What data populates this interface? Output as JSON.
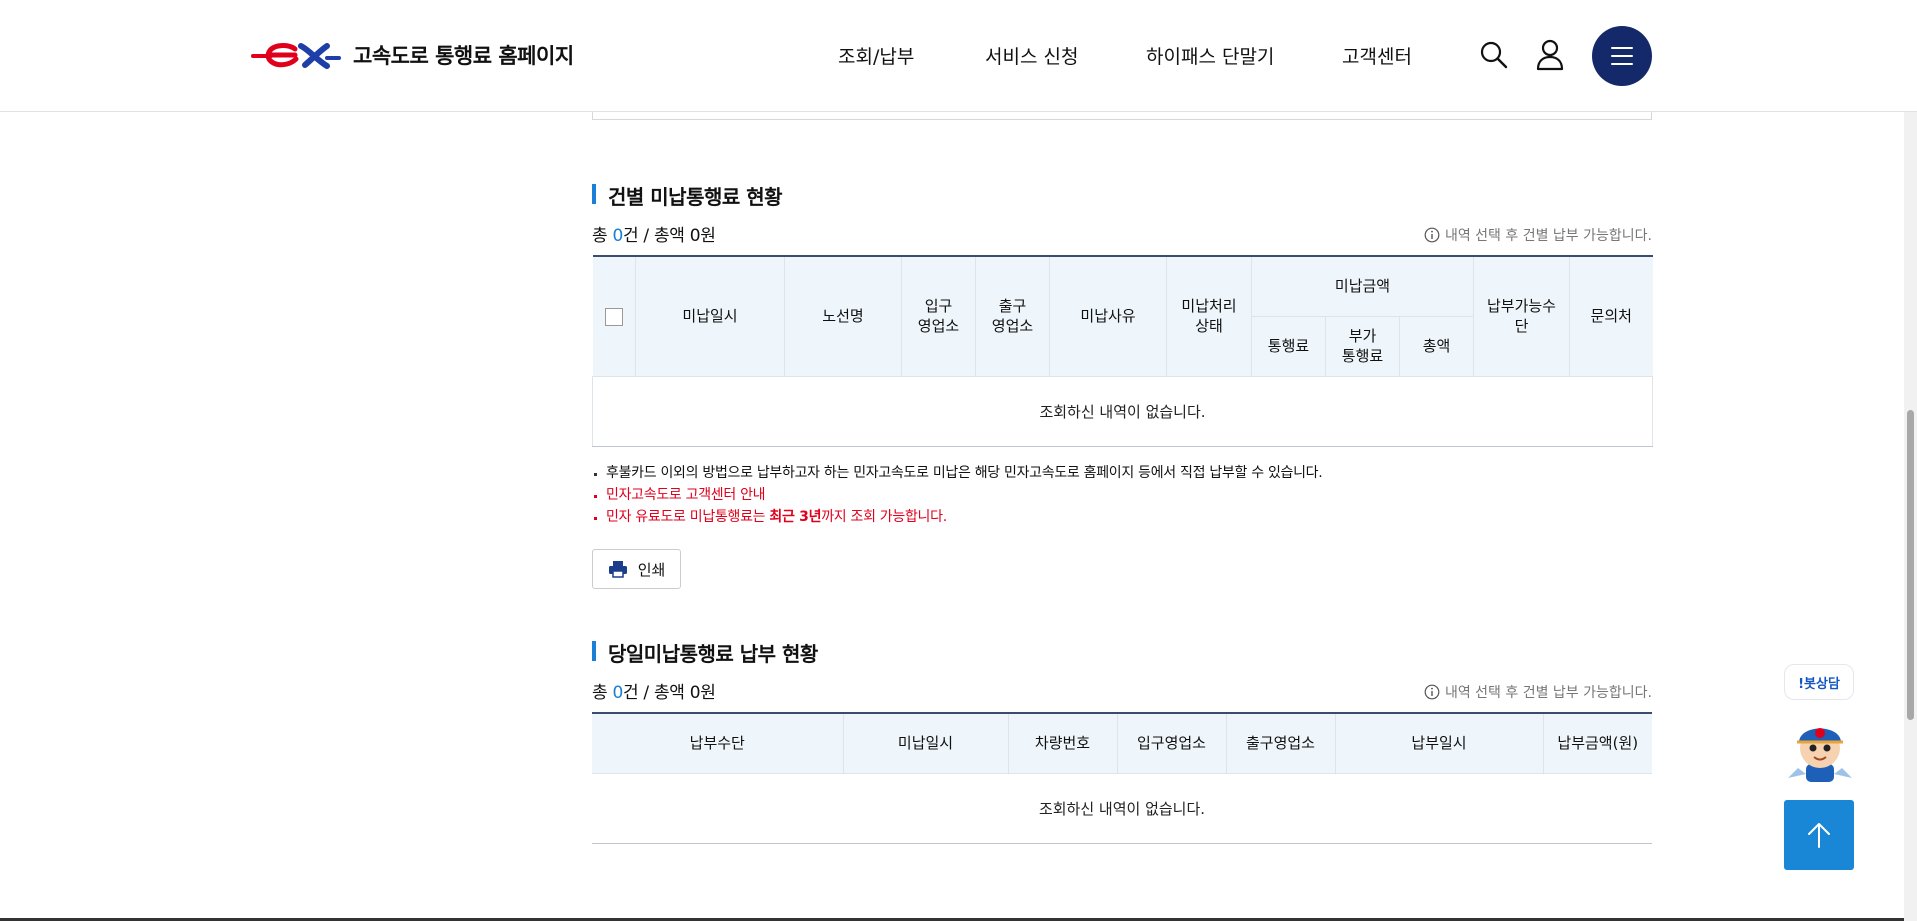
{
  "header": {
    "logo_text": "고속도로 통행료 홈페이지",
    "nav": [
      "조회/납부",
      "서비스 신청",
      "하이패스 단말기",
      "고객센터"
    ]
  },
  "section1": {
    "title": "건별 미납통행료 현황",
    "summary_prefix": "총 ",
    "count": "0",
    "summary_mid": "건 / 총액 0원",
    "note": "내역 선택 후 건별 납부 가능합니다.",
    "headers": {
      "date": "미납일시",
      "route": "노선명",
      "entry": "입구\n영업소",
      "exit": "출구\n영업소",
      "reason": "미납사유",
      "status": "미납처리\n상태",
      "amount_group": "미납금액",
      "toll": "통행료",
      "extra": "부가\n통행료",
      "total": "총액",
      "pay_method": "납부가능수\n단",
      "contact": "문의처"
    },
    "empty_text": "조회하신 내역이 없습니다."
  },
  "notices": {
    "line1": "후불카드 이외의 방법으로 납부하고자 하는 민자고속도로 미납은 해당 민자고속도로 홈페이지 등에서 직접 납부할 수 있습니다.",
    "line2": "민자고속도로 고객센터 안내",
    "line3_pre": "민자 유료도로 미납통행료는 ",
    "line3_bold": "최근 3년",
    "line3_post": "까지 조회 가능합니다."
  },
  "print_label": "인쇄",
  "section2": {
    "title": "당일미납통행료 납부 현황",
    "summary_prefix": "총 ",
    "count": "0",
    "summary_mid": "건 / 총액 0원",
    "note": "내역 선택 후 건별 납부 가능합니다.",
    "headers": [
      "납부수단",
      "미납일시",
      "차량번호",
      "입구영업소",
      "출구영업소",
      "납부일시",
      "납부금액(원)"
    ],
    "empty_text": "조회하신 내역이 없습니다."
  },
  "chatbot_label": "!봇상담",
  "colors": {
    "accent": "#1a7fd6",
    "navy": "#14296a",
    "red": "#e0001b",
    "header_bg": "#eef6fb"
  }
}
